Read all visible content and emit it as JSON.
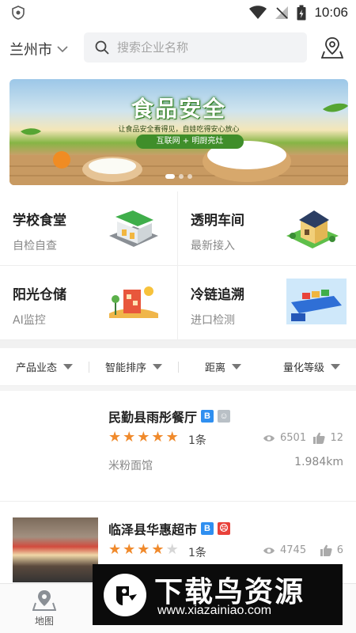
{
  "status_bar": {
    "time": "10:06"
  },
  "header": {
    "city": "兰州市",
    "search_placeholder": "搜索企业名称"
  },
  "banner": {
    "title": "食品安全",
    "subtitle": "让食品安全看得见，自娃吃得安心放心",
    "pill": "互联网 + 明厨亮灶",
    "dot_count": 3,
    "active_dot": 0
  },
  "categories": [
    {
      "title": "学校食堂",
      "subtitle": "自检自查",
      "icon": "school-canteen-icon"
    },
    {
      "title": "透明车间",
      "subtitle": "最新接入",
      "icon": "transparent-workshop-icon"
    },
    {
      "title": "阳光仓储",
      "subtitle": "AI监控",
      "icon": "sunshine-storage-icon"
    },
    {
      "title": "冷链追溯",
      "subtitle": "进口检测",
      "icon": "cold-chain-icon"
    }
  ],
  "filters": [
    {
      "label": "产品业态"
    },
    {
      "label": "智能排序"
    },
    {
      "label": "距离"
    },
    {
      "label": "量化等级"
    }
  ],
  "list": [
    {
      "name": "民勤县雨彤餐厅",
      "badges": [
        "B",
        "☺"
      ],
      "rating": 5,
      "count": "1条",
      "views": "6501",
      "likes": "12",
      "category": "米粉面馆",
      "distance": "1.984km"
    },
    {
      "name": "临泽县华惠超市",
      "badges": [
        "B",
        "☹"
      ],
      "rating": 4,
      "count": "1条",
      "views": "4745",
      "likes": "6"
    }
  ],
  "tabbar": {
    "tab_map": "地图"
  },
  "watermark": {
    "title": "下载鸟资源",
    "url": "www.xiazainiao.com"
  },
  "colors": {
    "star": "#f08a2c",
    "badge_blue": "#2f8ff0",
    "badge_red": "#e8413a",
    "badge_grey": "#b9c0c6"
  }
}
